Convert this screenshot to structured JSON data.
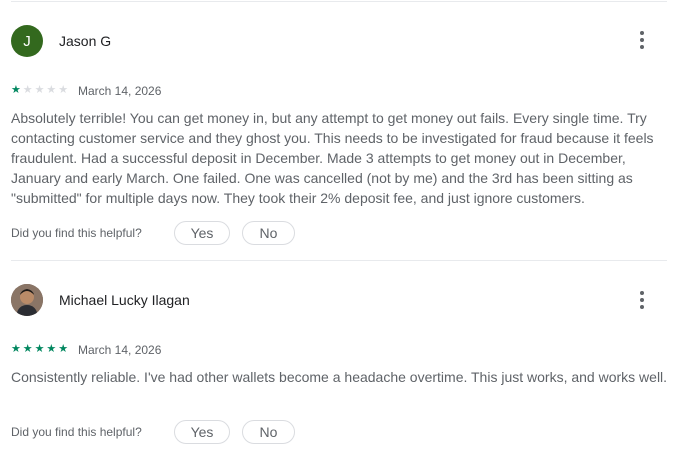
{
  "colors": {
    "accent_green": "#01875f",
    "avatar_j_bg": "#33691e",
    "text_secondary": "#5f6368"
  },
  "reviews": [
    {
      "author": "Jason G",
      "avatar_letter": "J",
      "rating": 1,
      "max_rating": 5,
      "date": "March 14, 2026",
      "text": "Absolutely terrible! You can get money in, but any attempt to get money out fails. Every single time. Try contacting customer service and they ghost you. This needs to be investigated for fraud because it feels fraudulent. Had a successful deposit in December. Made 3 attempts to get money out in December, January and early March. One failed. One was cancelled (not by me) and the 3rd has been sitting as \"submitted\" for multiple days now. They took their 2% deposit fee, and just ignore customers.",
      "helpful_prompt": "Did you find this helpful?",
      "yes_label": "Yes",
      "no_label": "No",
      "more_icon": "more-vert-icon"
    },
    {
      "author": "Michael Lucky Ilagan",
      "avatar_letter": "",
      "rating": 5,
      "max_rating": 5,
      "date": "March 14, 2026",
      "text": "Consistently reliable. I've had other wallets become a headache overtime. This just works, and works well.",
      "helpful_prompt": "Did you find this helpful?",
      "yes_label": "Yes",
      "no_label": "No",
      "more_icon": "more-vert-icon"
    }
  ]
}
